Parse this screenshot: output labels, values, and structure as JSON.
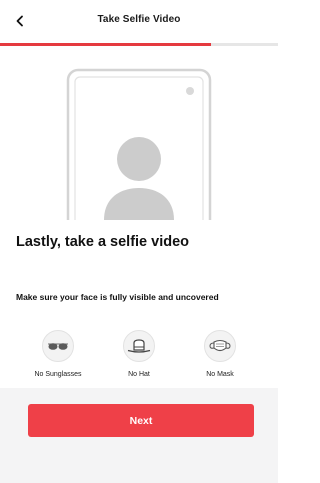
{
  "header": {
    "title": "Take Selfie Video",
    "back_icon": "chevron-left-icon"
  },
  "progress": {
    "fraction": 0.76,
    "color": "#e53a3f"
  },
  "content": {
    "headline": "Lastly, take a selfie video",
    "instruction": "Make sure your face is fully visible and uncovered"
  },
  "requirements": [
    {
      "label": "No Sunglasses",
      "icon": "sunglasses-icon"
    },
    {
      "label": "No Hat",
      "icon": "hat-icon"
    },
    {
      "label": "No Mask",
      "icon": "mask-icon"
    }
  ],
  "footer": {
    "next_label": "Next",
    "accent": "#ef4048"
  }
}
